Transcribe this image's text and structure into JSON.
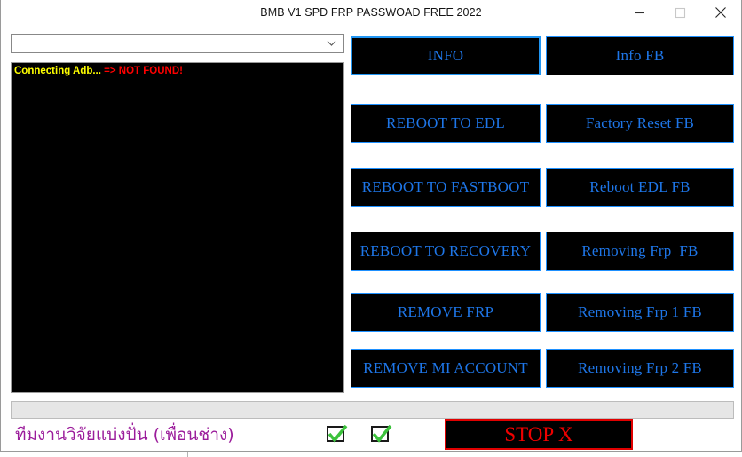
{
  "window": {
    "title": "BMB V1 SPD FRP PASSWOAD FREE 2022",
    "controls": {
      "minimize": "minimize-icon",
      "maximize": "maximize-icon",
      "close": "close-icon"
    }
  },
  "device_select": {
    "value": "",
    "placeholder": "",
    "chevron": "chevron-down-icon"
  },
  "log": {
    "lines": [
      {
        "text": "Connecting Adb... ",
        "color": "#ffff00"
      },
      {
        "text": "=> NOT FOUND!",
        "color": "#ff0000"
      }
    ],
    "line1": "Connecting Adb... ",
    "line2": "=> NOT FOUND!"
  },
  "buttons": {
    "left": [
      {
        "label": "INFO",
        "focused": true
      },
      {
        "label": "REBOOT TO EDL",
        "focused": false
      },
      {
        "label": "REBOOT TO FASTBOOT",
        "focused": false
      },
      {
        "label": "REBOOT TO RECOVERY",
        "focused": false
      },
      {
        "label": "REMOVE FRP",
        "focused": false
      },
      {
        "label": "REMOVE MI ACCOUNT",
        "focused": false
      }
    ],
    "right": [
      {
        "label": "Info FB",
        "focused": false
      },
      {
        "label": "Factory Reset FB",
        "focused": false
      },
      {
        "label": "Reboot EDL FB",
        "focused": false
      },
      {
        "label": "Removing Frp  FB",
        "focused": false
      },
      {
        "label": "Removing Frp 1 FB",
        "focused": false
      },
      {
        "label": "Removing Frp 2 FB",
        "focused": false
      }
    ]
  },
  "progress": {
    "value": 0,
    "label": ""
  },
  "footer": {
    "credit_text": "ทีมงานวิจัยแบ่งปั่น (เพื่อนช่าง)",
    "checkbox_1": {
      "name": "check-1",
      "checked": true
    },
    "checkbox_2": {
      "name": "check-2",
      "checked": true
    },
    "stop_label": "STOP X"
  },
  "colors": {
    "button_text": "#1e76e8",
    "button_border": "#1e90ff",
    "focus_border": "#2196f3",
    "log_bg": "#000000",
    "log_yellow": "#ffff00",
    "log_red": "#ff0000",
    "stop_red": "#ee0000",
    "credit_purple": "#9b1c9b",
    "check_green": "#3cc23c"
  }
}
